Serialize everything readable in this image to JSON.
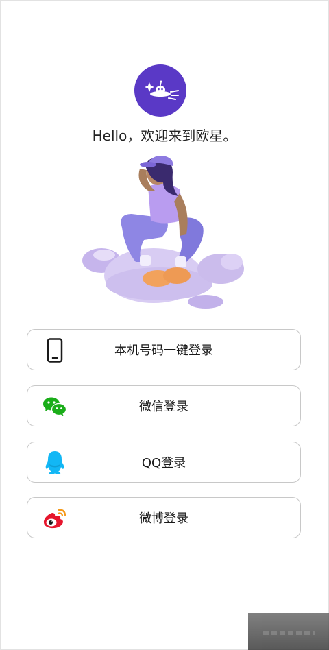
{
  "header": {
    "logo_icon": "planet-spaceship-icon",
    "greeting": "Hello，欢迎来到欧星。",
    "brand_color": "#5a39c6"
  },
  "illustration": {
    "icon": "girl-sitting-on-cloud-illustration"
  },
  "login_options": [
    {
      "label": "本机号码一键登录",
      "icon": "phone-icon"
    },
    {
      "label": "微信登录",
      "icon": "wechat-icon",
      "color": "#1aad19"
    },
    {
      "label": "QQ登录",
      "icon": "qq-icon",
      "color": "#12b7f5"
    },
    {
      "label": "微博登录",
      "icon": "weibo-icon",
      "color": "#e6162d"
    }
  ]
}
